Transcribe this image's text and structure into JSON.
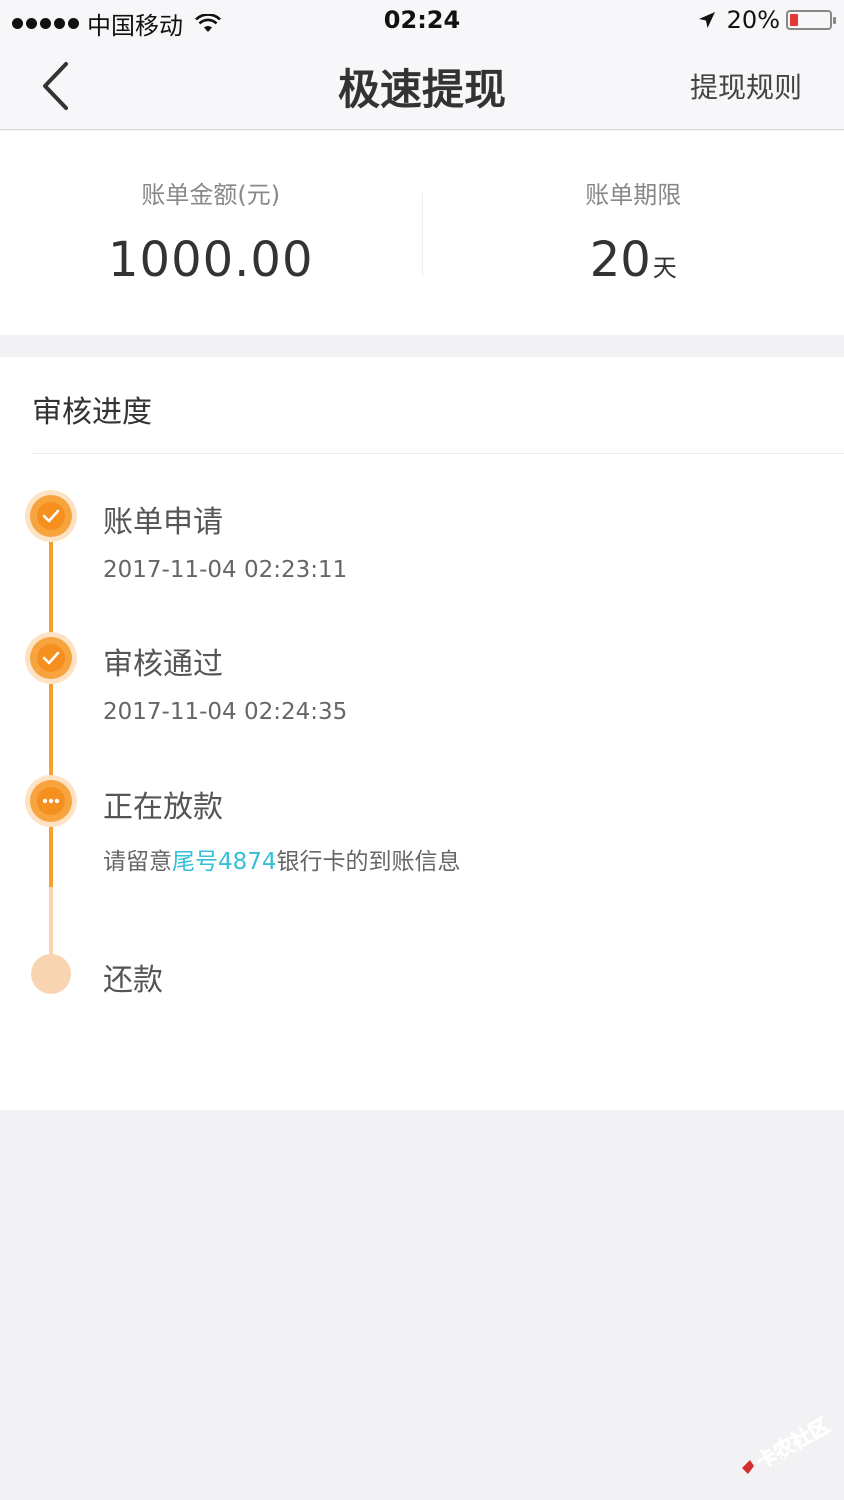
{
  "status_bar": {
    "carrier": "中国移动",
    "time": "02:24",
    "battery": "20%",
    "battery_level": 0.2
  },
  "nav": {
    "title": "极速提现",
    "rules_label": "提现规则"
  },
  "summary": {
    "amount_label": "账单金额(元)",
    "amount_value": "1000.00",
    "term_label": "账单期限",
    "term_value": "20",
    "term_unit": "天"
  },
  "progress": {
    "title": "审核进度",
    "steps": [
      {
        "name": "账单申请",
        "time": "2017-11-04 02:23:11",
        "status": "done"
      },
      {
        "name": "审核通过",
        "time": "2017-11-04 02:24:35",
        "status": "done"
      },
      {
        "name": "正在放款",
        "note_prefix": "请留意",
        "note_highlight": "尾号4874",
        "note_suffix": "银行卡的到账信息",
        "status": "in-progress"
      },
      {
        "name": "还款",
        "status": "pending"
      }
    ]
  },
  "watermark": {
    "text": "卡农社区"
  },
  "colors": {
    "accent_orange": "#f5901f",
    "pending_orange": "#f8d5b0",
    "highlight_cyan": "#36c0d6"
  }
}
